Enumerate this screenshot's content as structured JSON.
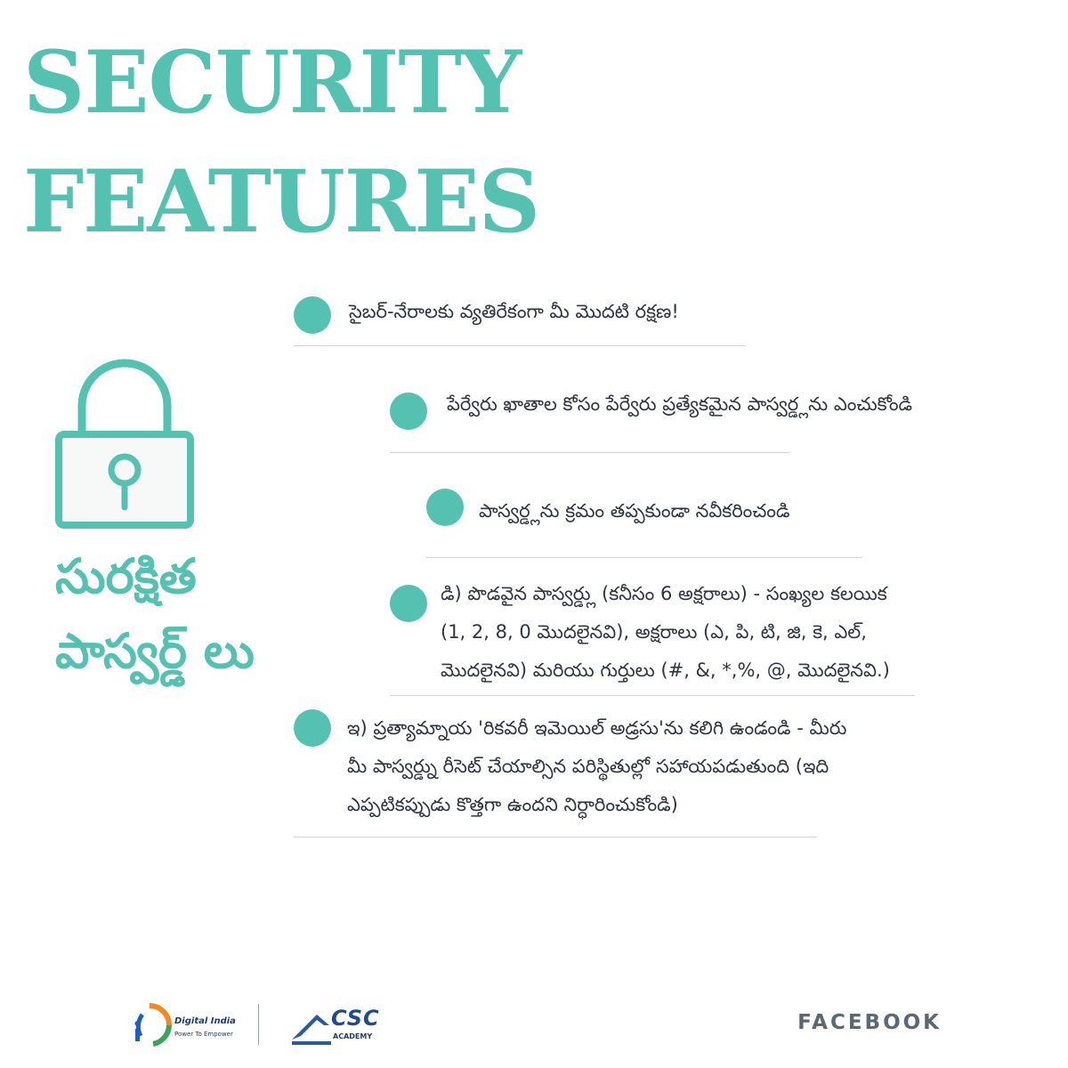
{
  "header": {
    "title_line1": "SECURITY",
    "title_line2": "FEATURES"
  },
  "side_label": {
    "line1": "సురక్షిత",
    "line2": "పాస్వర్డ్ లు"
  },
  "icons": {
    "lock": "lock-icon",
    "bullet": "bullet-dot-icon"
  },
  "colors": {
    "accent": "#55c1b0",
    "text": "#2f3540",
    "rule": "#cfd3d6",
    "footer_text": "#5a6775"
  },
  "items": [
    {
      "lines": [
        "సైబర్-నేరాలకు వ్యతిరేకంగా మీ మొదటి రక్షణ!"
      ]
    },
    {
      "lines": [
        "పేర్వేరు ఖాతాల కోసం పేర్వేరు ప్రత్యేకమైన పాస్వర్డ్లను ఎంచుకోండి"
      ]
    },
    {
      "lines": [
        "పాస్వర్డ్లను క్రమం తప్పకుండా నవీకరించండి"
      ]
    },
    {
      "lines": [
        "డి) పొడవైన పాస్వర్డ్లు (కనీసం 6 అక్షరాలు) - సంఖ్యల కలయిక",
        "(1, 2, 8, 0 మొదలైనవి), అక్షరాలు (ఎ, పి, టి, జి, కె, ఎల్,",
        "మొదలైనవి) మరియు గుర్తులు (#, &, *,%, @, మొదలైనవి.)"
      ]
    },
    {
      "lines": [
        "ఇ) ప్రత్యామ్నాయ 'రికవరీ ఇమెయిల్ అడ్రసు'ను కలిగి ఉండండి - మీరు",
        "మీ పాస్వర్డ్ను రీసెట్ చేయాల్సిన పరిస్థితుల్లో సహాయపడుతుంది (ఇది",
        "ఎప్పటికప్పుడు కొత్తగా ఉందని నిర్ధారించుకోండి)"
      ]
    }
  ],
  "footer": {
    "digital_india_name": "Digital India",
    "digital_india_tagline": "Power To Empower",
    "csc_name": "CSC",
    "csc_sub": "ACADEMY",
    "platform": "FACEBOOK"
  }
}
